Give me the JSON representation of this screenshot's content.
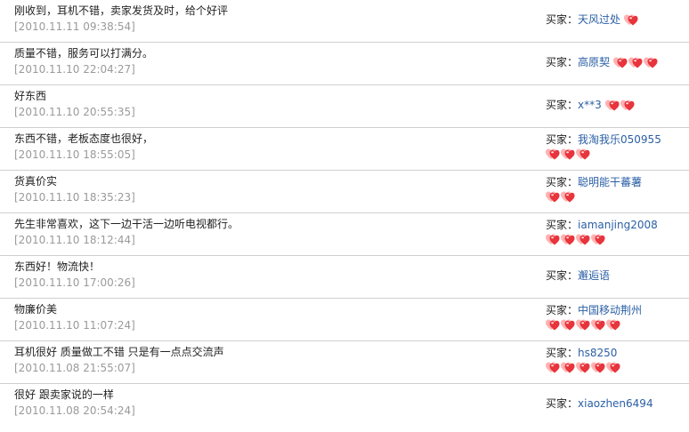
{
  "buyer_label": "买家：",
  "reviews": [
    {
      "comment": "刚收到，耳机不错，卖家发货及时，给个好评",
      "date": "[2010.11.11 09:38:54]",
      "buyer": "天风过处",
      "hearts": 1,
      "layout": "inline"
    },
    {
      "comment": "质量不错，服务可以打满分。",
      "date": "[2010.11.10 22:04:27]",
      "buyer": "高原契",
      "hearts": 3,
      "layout": "inline"
    },
    {
      "comment": "好东西",
      "date": "[2010.11.10 20:55:35]",
      "buyer": "x**3",
      "hearts": 2,
      "layout": "inline"
    },
    {
      "comment": "东西不错，老板态度也很好，",
      "date": "[2010.11.10 18:55:05]",
      "buyer": "我淘我乐050955",
      "hearts": 3,
      "layout": "block"
    },
    {
      "comment": "货真价实",
      "date": "[2010.11.10 18:35:23]",
      "buyer": "聪明能干蕃薯",
      "hearts": 2,
      "layout": "block"
    },
    {
      "comment": "先生非常喜欢，这下一边干活一边听电视都行。",
      "date": "[2010.11.10 18:12:44]",
      "buyer": "iamanjing2008",
      "hearts": 4,
      "layout": "block"
    },
    {
      "comment": "东西好！物流快！",
      "date": "[2010.11.10 17:00:26]",
      "buyer": "邂逅语",
      "hearts": 0,
      "layout": "inline"
    },
    {
      "comment": "物廉价美",
      "date": "[2010.11.10 11:07:24]",
      "buyer": "中国移动荆州",
      "hearts": 5,
      "layout": "block"
    },
    {
      "comment": "耳机很好 质量做工不错 只是有一点点交流声",
      "date": "[2010.11.08 21:55:07]",
      "buyer": "hs8250",
      "hearts": 5,
      "layout": "block"
    },
    {
      "comment": "很好 跟卖家说的一样",
      "date": "[2010.11.08 20:54:24]",
      "buyer": "xiaozhen6494",
      "hearts": 0,
      "layout": "inline"
    }
  ],
  "colors": {
    "heart_red": "#e8343c",
    "buyer_link": "#2a5fa5",
    "date_gray": "#9a9a9a",
    "divider": "#cfcfcf"
  }
}
